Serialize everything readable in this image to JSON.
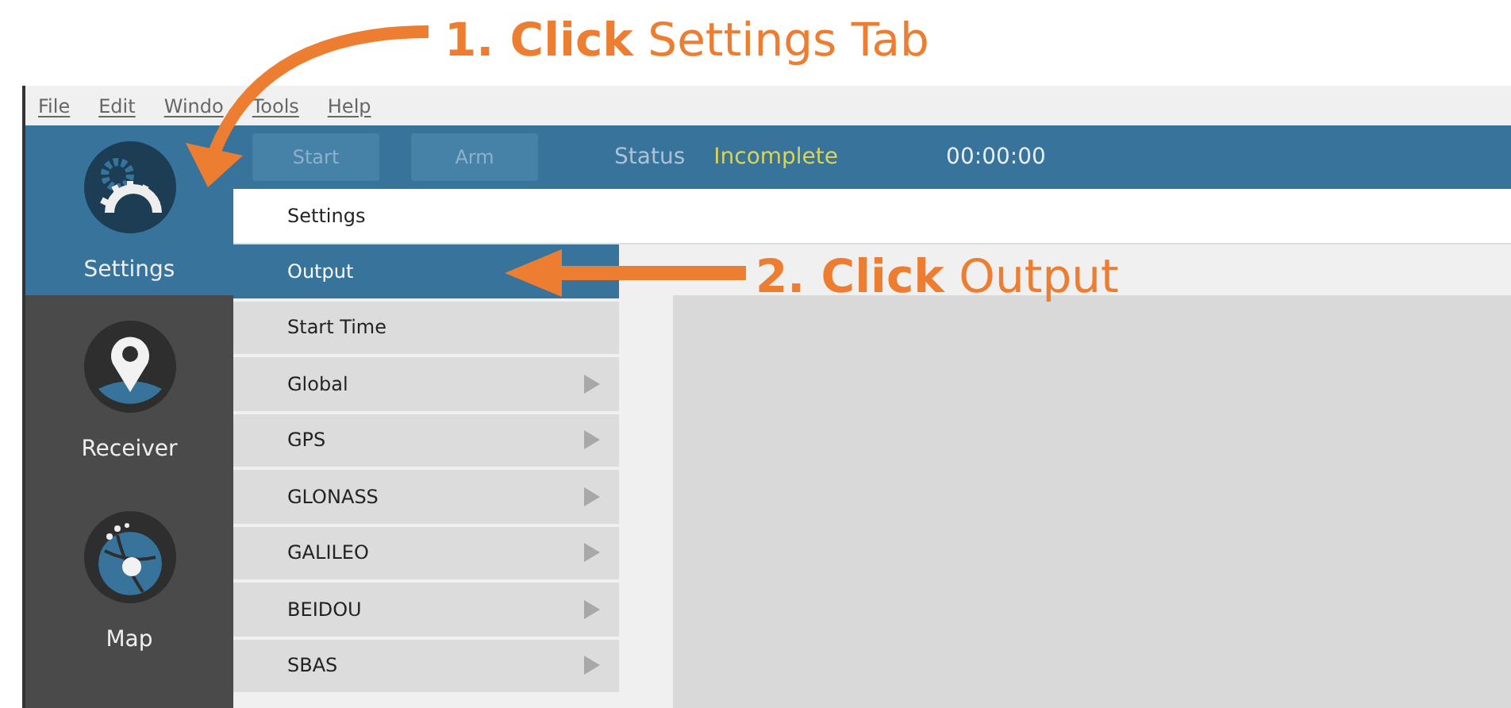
{
  "annotations": [
    {
      "text": "**1. Click** Settings Tab"
    },
    {
      "text": "**2. Click** Output"
    }
  ],
  "menu": [
    "File",
    "Edit",
    "Windo",
    "Tools",
    "Help"
  ],
  "sidebar": {
    "items": [
      {
        "label": "Settings",
        "kind": "gear",
        "selected": true
      },
      {
        "label": "Receiver",
        "kind": "pin",
        "selected": false
      },
      {
        "label": "Map",
        "kind": "globe",
        "selected": false
      }
    ]
  },
  "toolbar": {
    "buttons": [
      {
        "label": "Start",
        "disabled": true
      },
      {
        "label": "Arm",
        "disabled": true
      }
    ],
    "status_label": "Status",
    "status_value": "Incomplete",
    "timer": "00:00:00"
  },
  "header": "Settings",
  "list": [
    {
      "label": "Output",
      "selected": true,
      "expandable": false
    },
    {
      "label": "Start Time",
      "selected": false,
      "expandable": false
    },
    {
      "label": "Global",
      "selected": false,
      "expandable": true
    },
    {
      "label": "GPS",
      "selected": false,
      "expandable": true
    },
    {
      "label": "GLONASS",
      "selected": false,
      "expandable": true
    },
    {
      "label": "GALILEO",
      "selected": false,
      "expandable": true
    },
    {
      "label": "BEIDOU",
      "selected": false,
      "expandable": true
    },
    {
      "label": "SBAS",
      "selected": false,
      "expandable": true
    }
  ]
}
